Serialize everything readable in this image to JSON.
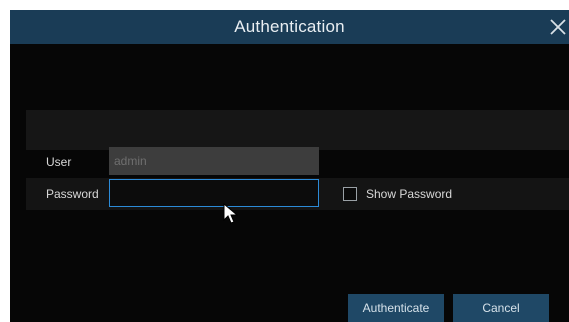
{
  "dialog": {
    "title": "Authentication",
    "close_icon": "close-icon"
  },
  "form": {
    "user_label": "User",
    "user_value": "admin",
    "password_label": "Password",
    "password_value": "",
    "show_password_label": "Show Password",
    "show_password_checked": false
  },
  "buttons": {
    "authenticate_label": "Authenticate",
    "cancel_label": "Cancel"
  },
  "colors": {
    "titlebar": "#1a3c56",
    "focus_border": "#2c8bd8",
    "button": "#1f4866"
  },
  "icons": {
    "cursor": "mouse-pointer-icon"
  }
}
